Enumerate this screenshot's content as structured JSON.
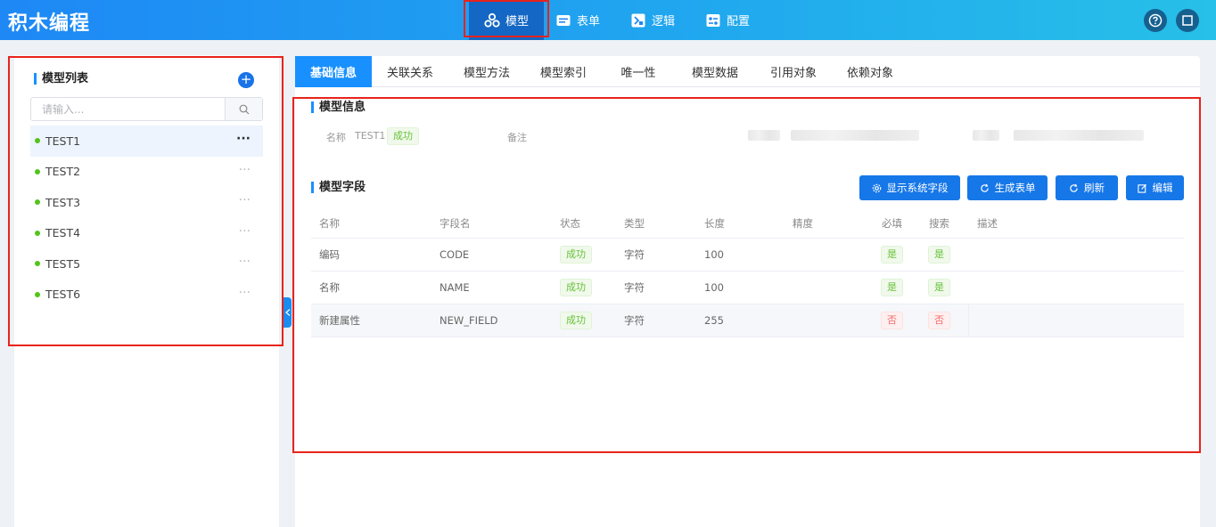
{
  "app": {
    "title": "积木编程"
  },
  "nav": [
    {
      "label": "模型",
      "icon": "model-icon"
    },
    {
      "label": "表单",
      "icon": "form-icon"
    },
    {
      "label": "逻辑",
      "icon": "logic-icon"
    },
    {
      "label": "配置",
      "icon": "config-icon"
    }
  ],
  "header_actions": {
    "help_icon": "help-icon",
    "window_icon": "window-icon"
  },
  "sidebar": {
    "title": "模型列表",
    "add_label": "+",
    "search_placeholder": "请输入...",
    "items": [
      {
        "name": "TEST1",
        "status_color": "#52c41a"
      },
      {
        "name": "TEST2",
        "status_color": "#52c41a"
      },
      {
        "name": "TEST3",
        "status_color": "#52c41a"
      },
      {
        "name": "TEST4",
        "status_color": "#52c41a"
      },
      {
        "name": "TEST5",
        "status_color": "#52c41a"
      },
      {
        "name": "TEST6",
        "status_color": "#52c41a"
      }
    ],
    "more_label": "···"
  },
  "tabs": [
    "基础信息",
    "关联关系",
    "模型方法",
    "模型索引",
    "唯一性",
    "模型数据",
    "引用对象",
    "依赖对象"
  ],
  "model_info": {
    "title": "模型信息",
    "name_label": "名称",
    "name_value": "TEST1",
    "status": "成功",
    "remark_label": "备注"
  },
  "model_fields": {
    "title": "模型字段",
    "buttons": [
      {
        "label": "显示系统字段",
        "icon": "gear-icon"
      },
      {
        "label": "生成表单",
        "icon": "refresh-icon"
      },
      {
        "label": "刷新",
        "icon": "refresh-icon"
      },
      {
        "label": "编辑",
        "icon": "edit-icon"
      }
    ],
    "columns": [
      "名称",
      "字段名",
      "状态",
      "类型",
      "长度",
      "精度",
      "必填",
      "搜索",
      "描述"
    ],
    "rows": [
      {
        "name": "编码",
        "field": "CODE",
        "status": "成功",
        "type": "字符",
        "length": "100",
        "precision": "",
        "required": "是",
        "search": "是",
        "desc": ""
      },
      {
        "name": "名称",
        "field": "NAME",
        "status": "成功",
        "type": "字符",
        "length": "100",
        "precision": "",
        "required": "是",
        "search": "是",
        "desc": ""
      },
      {
        "name": "新建属性",
        "field": "NEW_FIELD",
        "status": "成功",
        "type": "字符",
        "length": "255",
        "precision": "",
        "required": "否",
        "search": "否",
        "desc": ""
      }
    ]
  },
  "colors": {
    "accent": "#1890ff",
    "success": "#67c23a",
    "danger": "#f56c6c",
    "highlight": "#e8231b"
  }
}
